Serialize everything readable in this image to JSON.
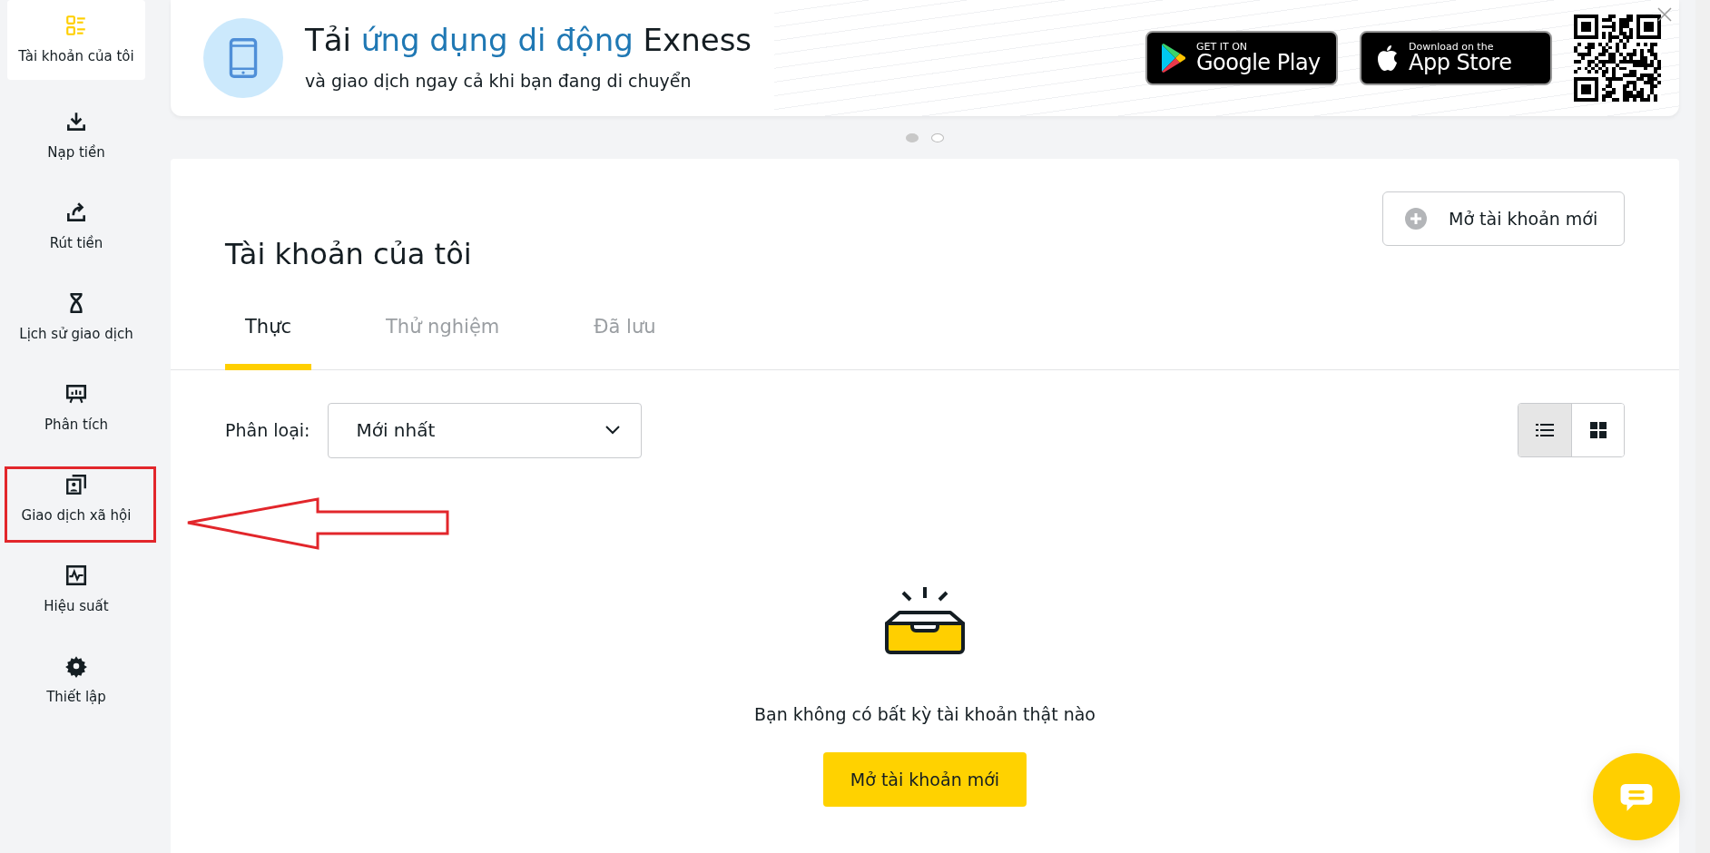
{
  "sidebar": {
    "items": [
      {
        "label": "Tài khoản của tôi",
        "selected": true
      },
      {
        "label": "Nạp tiền",
        "selected": false
      },
      {
        "label": "Rút tiền",
        "selected": false
      },
      {
        "label": "Lịch sử giao dịch",
        "selected": false
      },
      {
        "label": "Phân tích",
        "selected": false
      },
      {
        "label": "Giao dịch xã hội",
        "selected": false
      },
      {
        "label": "Hiệu suất",
        "selected": false
      },
      {
        "label": "Thiết lập",
        "selected": false
      }
    ]
  },
  "banner": {
    "title_parts": [
      {
        "text": "Tải ",
        "highlight": false
      },
      {
        "text": "ứng dụng di động",
        "highlight": true
      },
      {
        "text": " Exness",
        "highlight": false
      }
    ],
    "subtitle": "và giao dịch ngay cả khi bạn đang di chuyển",
    "stores": [
      {
        "kind": "google",
        "small": "GET IT ON",
        "big": "Google Play"
      },
      {
        "kind": "apple",
        "small": "Download on the",
        "big": "App Store"
      }
    ],
    "dots": [
      {
        "selected": true
      },
      {
        "selected": false
      }
    ]
  },
  "accounts": {
    "title": "Tài khoản của tôi",
    "open_button": "Mở tài khoản mới",
    "tabs": [
      {
        "label": "Thực",
        "selected": true
      },
      {
        "label": "Thử nghiệm",
        "selected": false
      },
      {
        "label": "Đã lưu",
        "selected": false
      }
    ],
    "sort_label": "Phân loại:",
    "sort_value": "Mới nhất",
    "views": [
      {
        "kind": "list",
        "selected": true
      },
      {
        "kind": "grid",
        "selected": false
      }
    ],
    "empty_text": "Bạn không có bất kỳ tài khoản thật nào",
    "empty_button": "Mở tài khoản mới"
  }
}
